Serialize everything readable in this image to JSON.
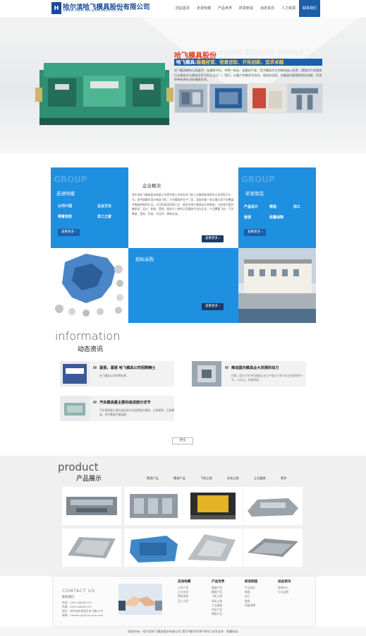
{
  "header": {
    "logo_mark": "H",
    "company_cn": "哈尔滨哈飞模具股份有限公司",
    "company_en": "Harbin Hafei Die Joine-stock Co.,Ltd",
    "nav": [
      "回站首页",
      "走进哈模",
      "产品世界",
      "研发制造",
      "动态资讯",
      "人力资源",
      "联系我们"
    ],
    "active_nav": "联系我们"
  },
  "banner": {
    "brand": "哈飞模具股份",
    "brand_en": "HAFEI SHARES MOULD",
    "slogan_a": "哈飞模具:",
    "slogan_b": "稳健经营、锐意进取、开拓创新、追求卓越",
    "desc": "哈飞模具拥有以高速冲、钛精密冲压、冲焊一体化、轻量化汽车、铝冲模具为主的模具核心技术，是国内汽车模具行业最有实力最具竞争力的企业之一；我们，以客户的需求为导向，诚信的态度，用精益的管理和科技创新，为世界带来更先进的模具技术。"
  },
  "grid": {
    "watermark": "GROUP",
    "about": {
      "title": "走进哈模",
      "links": [
        "公司介绍",
        "企业文化",
        "荣誉资质",
        "员工之家"
      ],
      "more": "查看更多"
    },
    "intro": {
      "title": "企业概况",
      "text": "哈尔滨哈飞模具股份有限公司是中航工业哈尔滨飞机工业集团有限责任公司控股子公司，是中国最早设计制造飞机、汽车模具的生产厂家，是国内第一家从事大型汽车覆盖件模具研制的企业；公司积极采用新工艺、新技术进行模具设计和制造，已经成为国内集研发、设计、制造、营销、服务为一体的大型模具专业化企业，产品覆盖飞机、汽车模具、检具、夹具、冲压件、焊装总成。",
      "more": "查看更多"
    },
    "rd": {
      "title": "研发制造",
      "links": [
        "产品设计",
        "铸造",
        "加工",
        "装调",
        "质量保障"
      ],
      "more": "查看更多"
    },
    "bid": {
      "title": "招标采购",
      "more": "查看更多"
    }
  },
  "news": {
    "title_en": "information",
    "title_cn": "动态资讯",
    "items": [
      {
        "title": "喜报，喜报 哈飞模具公司招聘精士",
        "body": "哈飞模具公司招聘启事..."
      },
      {
        "title": "推动国内模具业大发展的动力",
        "body": "目前，国内汽车冲压模具企业生产能力只有汽车企业需求的一半，70亿元，供需矛盾..."
      },
      {
        "title": "汽车模具最主要的组成部分详节",
        "body": "汽车模具最主要的组成部分包括覆盖件模具、注塑模具、压铸模具，其中覆盖件模具最..."
      }
    ],
    "more": "更多"
  },
  "product": {
    "title_en": "product",
    "title_cn": "产品展示",
    "tabs": [
      "铸造产品",
      "模具产品",
      "飞机工装",
      "非标工装",
      "工位器具",
      "更多"
    ]
  },
  "footer": {
    "contact_en": "CONTACT US",
    "contact_cn": "联系我们",
    "lines": [
      "电话：0451-86582755",
      "传真：0451-86582755",
      "地址：哈尔滨市香坊区哈飞路15号",
      "邮箱：hafeimuju@vip.sina.com"
    ],
    "cols": [
      {
        "h": "走进哈模",
        "items": [
          "公司介绍",
          "企业文化",
          "荣誉资质",
          "员工之家"
        ]
      },
      {
        "h": "产品世界",
        "items": [
          "铸造产品",
          "模具产品",
          "飞机工装",
          "非标工装",
          "工位器具",
          "冲压产品",
          "焊接产品"
        ]
      },
      {
        "h": "研发制造",
        "items": [
          "产品设计",
          "铸造",
          "加工",
          "装调",
          "质量保障"
        ]
      },
      {
        "h": "动态资讯",
        "items": [
          "新闻中心",
          "行业动态"
        ]
      }
    ],
    "copyright": "版权所有：哈尔滨哈飞模具股份有限公司 黑ICP备05008748号 技术支持：网赢科技"
  },
  "colors": {
    "brand_blue": "#1a5fa8",
    "cell_blue": "#1f8fe0",
    "accent_red": "#e33a1c"
  }
}
